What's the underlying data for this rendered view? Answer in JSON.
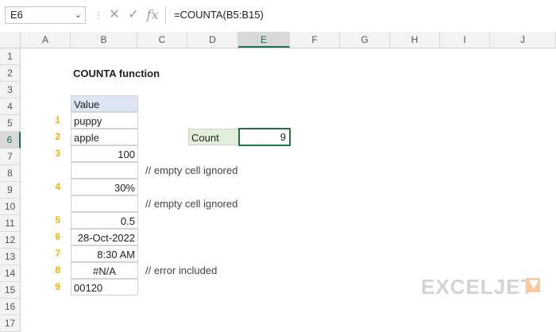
{
  "namebox": "E6",
  "formula": "=COUNTA(B5:B15)",
  "icons": {
    "dropdown": "chevron-down-icon",
    "cancel": "cancel-x-icon",
    "enter": "checkmark-icon",
    "fx": "fx-icon"
  },
  "columns": [
    "A",
    "B",
    "C",
    "D",
    "E",
    "F",
    "G",
    "H",
    "I",
    "J"
  ],
  "rows": [
    "1",
    "2",
    "3",
    "4",
    "5",
    "6",
    "7",
    "8",
    "9",
    "10",
    "11",
    "12",
    "13",
    "14",
    "15",
    "16",
    "17"
  ],
  "title": "COUNTA function",
  "header": "Value",
  "values": {
    "b5": "puppy",
    "b6": "apple",
    "b7": "100",
    "b9": "30%",
    "b11": "0.5",
    "b12": "28-Oct-2022",
    "b13": "8:30 AM",
    "b14": "#N/A",
    "b15": "00120"
  },
  "counters": {
    "a5": "1",
    "a6": "2",
    "a7": "3",
    "a9": "4",
    "a11": "5",
    "a12": "6",
    "a13": "7",
    "a14": "8",
    "a15": "9"
  },
  "comments": {
    "c8": "// empty cell ignored",
    "c10": "// empty cell ignored",
    "c14": "// error included"
  },
  "count": {
    "label": "Count",
    "value": "9"
  },
  "logo": "EXCELJET",
  "colors": {
    "accent": "#217346",
    "header_fill": "#dce6f4",
    "label_fill": "#e2efda",
    "counter": "#f0b400"
  }
}
